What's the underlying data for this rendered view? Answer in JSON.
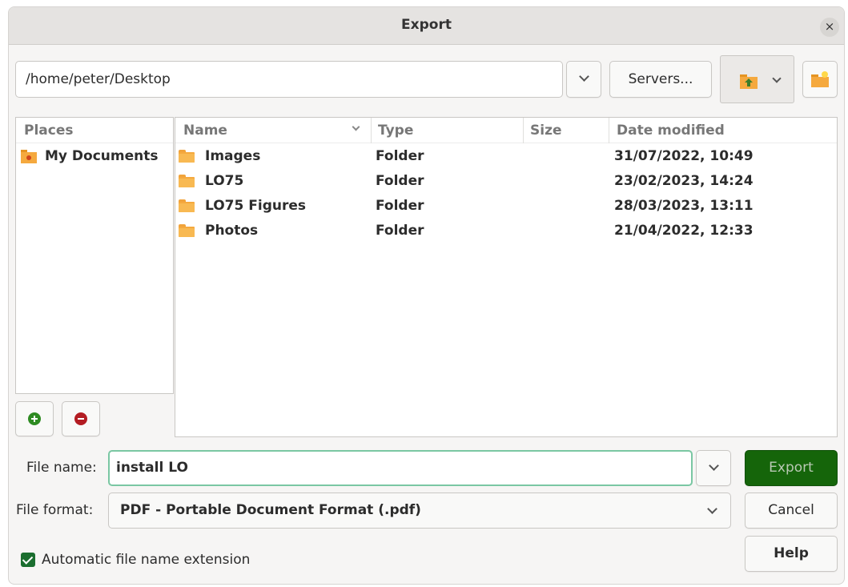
{
  "window": {
    "title": "Export",
    "close_glyph": "×"
  },
  "toolbar": {
    "path": "/home/peter/Desktop",
    "servers_label": "Servers..."
  },
  "places": {
    "header": "Places",
    "items": [
      {
        "label": "My Documents",
        "icon": "folder-star-icon"
      }
    ]
  },
  "files": {
    "columns": [
      "Name",
      "Type",
      "Size",
      "Date modified"
    ],
    "rows": [
      {
        "name": "Images",
        "type": "Folder",
        "size": "",
        "date": "31/07/2022, 10:49"
      },
      {
        "name": "LO75",
        "type": "Folder",
        "size": "",
        "date": "23/02/2023, 14:24"
      },
      {
        "name": "LO75 Figures",
        "type": "Folder",
        "size": "",
        "date": "28/03/2023, 13:11"
      },
      {
        "name": "Photos",
        "type": "Folder",
        "size": "",
        "date": "21/04/2022, 12:33"
      }
    ]
  },
  "form": {
    "filename_label": "File name:",
    "filename_value": "install LO",
    "format_label": "File format:",
    "format_value": "PDF - Portable Document Format (.pdf)",
    "auto_ext_label": "Automatic file name extension",
    "auto_ext_checked": true
  },
  "buttons": {
    "export": "Export",
    "cancel": "Cancel",
    "help": "Help"
  },
  "colors": {
    "export_bg": "#15650a",
    "focus_border": "#7ac7a3",
    "folder": "#f5a93e",
    "add": "#2e8b22",
    "remove": "#b31c23"
  }
}
